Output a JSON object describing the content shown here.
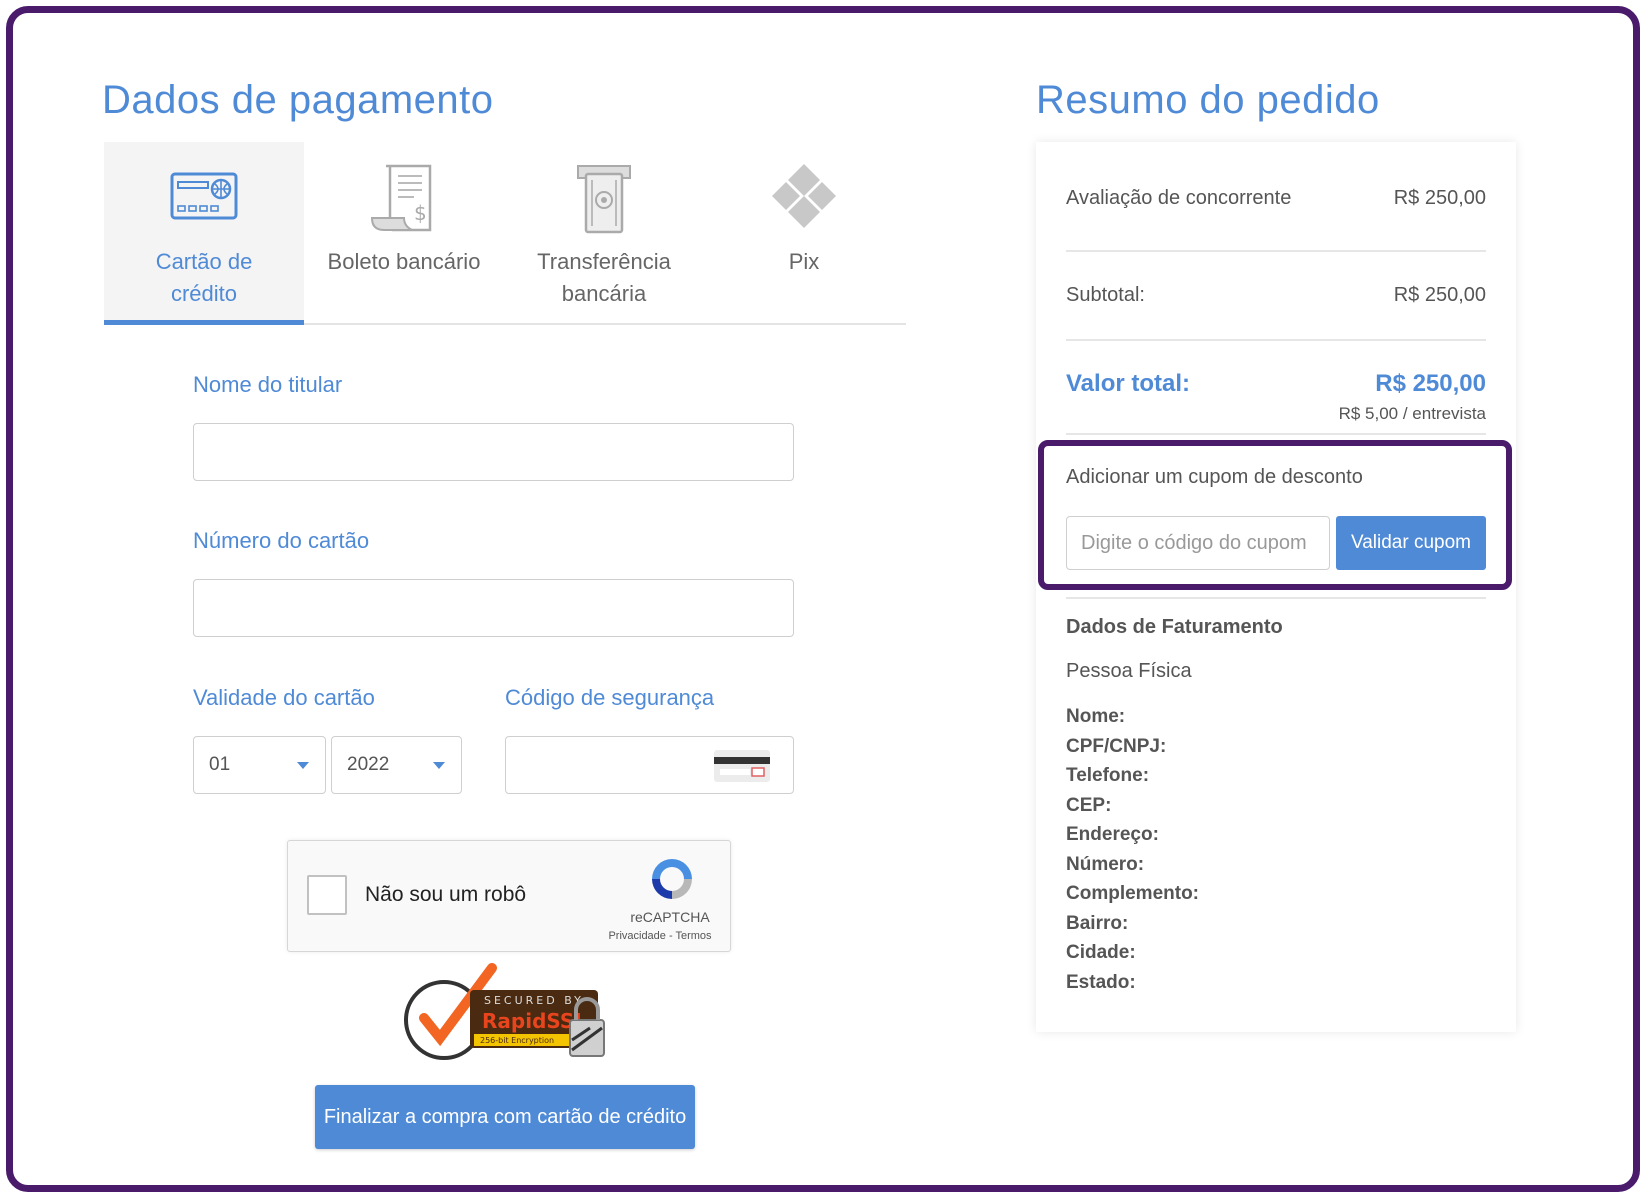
{
  "payment": {
    "title": "Dados de pagamento",
    "tabs": [
      {
        "label": "Cartão de crédito",
        "line1": "Cartão de",
        "line2": "crédito",
        "icon": "credit-card-icon",
        "active": true
      },
      {
        "label": "Boleto bancário",
        "icon": "boleto-receipt-icon",
        "active": false
      },
      {
        "label": "Transferência bancária",
        "line1": "Transferência",
        "line2": "bancária",
        "icon": "bank-transfer-icon",
        "active": false
      },
      {
        "label": "Pix",
        "icon": "pix-icon",
        "active": false
      }
    ],
    "holder_label": "Nome do titular",
    "holder_value": "",
    "card_number_label": "Número do cartão",
    "card_number_value": "",
    "expiry_label": "Validade do cartão",
    "expiry_month": "01",
    "expiry_year": "2022",
    "cvv_label": "Código de segurança",
    "cvv_value": "",
    "captcha": {
      "text": "Não sou um robô",
      "brand": "reCAPTCHA",
      "terms": "Privacidade - Termos"
    },
    "ssl_badge": {
      "secured_by": "SECURED BY",
      "brand": "RapidSSL",
      "encryption": "256-bit Encryption"
    },
    "finish_button": "Finalizar a compra com cartão de crédito"
  },
  "summary": {
    "title": "Resumo do pedido",
    "item_label": "Avaliação de concorrente",
    "item_value": "R$ 250,00",
    "subtotal_label": "Subtotal:",
    "subtotal_value": "R$ 250,00",
    "total_label": "Valor total:",
    "total_value": "R$ 250,00",
    "per_interview": "R$ 5,00 / entrevista",
    "coupon_label": "Adicionar um cupom de desconto",
    "coupon_placeholder": "Digite o código do cupom",
    "coupon_button": "Validar cupom",
    "billing_title": "Dados de Faturamento",
    "person_type": "Pessoa Física",
    "billing_fields": [
      "Nome:",
      "CPF/CNPJ:",
      "Telefone:",
      "CEP:",
      "Endereço:",
      "Número:",
      "Complemento:",
      "Bairro:",
      "Cidade:",
      "Estado:"
    ]
  },
  "colors": {
    "accent": "#4f8ad6",
    "highlight_border": "#4a1a6b",
    "text": "#555555"
  }
}
